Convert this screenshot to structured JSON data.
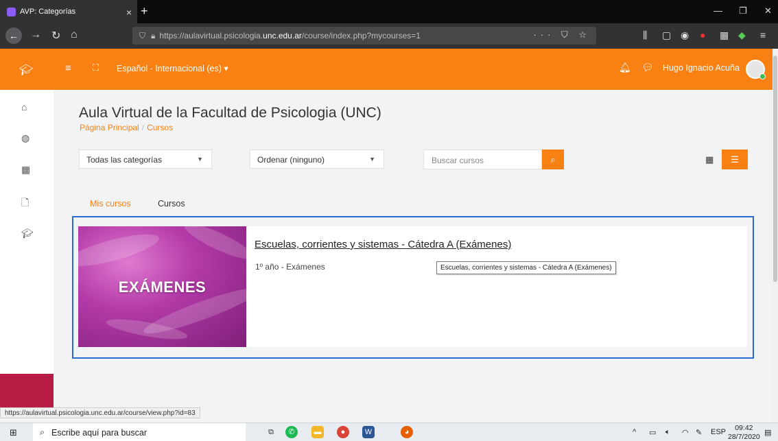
{
  "browser": {
    "tab_title": "AVP: Categorías",
    "tab_close": "×",
    "new_tab": "+",
    "url_prefix": "https://aulavirtual.psicologia.",
    "url_domain": "unc.edu.ar",
    "url_suffix": "/course/index.php?mycourses=1",
    "page_actions": "··· ⛉ ☆",
    "status_url": "https://aulavirtual.psicologia.unc.edu.ar/course/view.php?id=83"
  },
  "navbar": {
    "language": "Español - Internacional (es) ▾",
    "username": "Hugo Ignacio Acuña"
  },
  "page": {
    "title": "Aula Virtual de la Facultad de Psicologia (UNC)",
    "breadcrumb": [
      "Página Principal",
      "Cursos"
    ],
    "breadcrumb_sep": "/"
  },
  "filters": {
    "category": "Todas las categorías",
    "sort": "Ordenar (ninguno)",
    "search_placeholder": "Buscar cursos"
  },
  "tabs": {
    "mine": "Mis cursos",
    "all": "Cursos"
  },
  "course": {
    "image_label": "EXÁMENES",
    "title": "Escuelas, corrientes y sistemas - Cátedra A (Exámenes)",
    "category": "1º año - Exámenes",
    "tooltip": "Escuelas, corrientes y sistemas - Cátedra A (Exámenes)"
  },
  "taskbar": {
    "search_text": "Escribe aquí para buscar",
    "lang": "ESP",
    "time": "09:42",
    "date": "28/7/2020"
  },
  "colors": {
    "accent": "#f98012",
    "selection": "#2b6ad6",
    "drawer_bottom": "#b61c44"
  }
}
